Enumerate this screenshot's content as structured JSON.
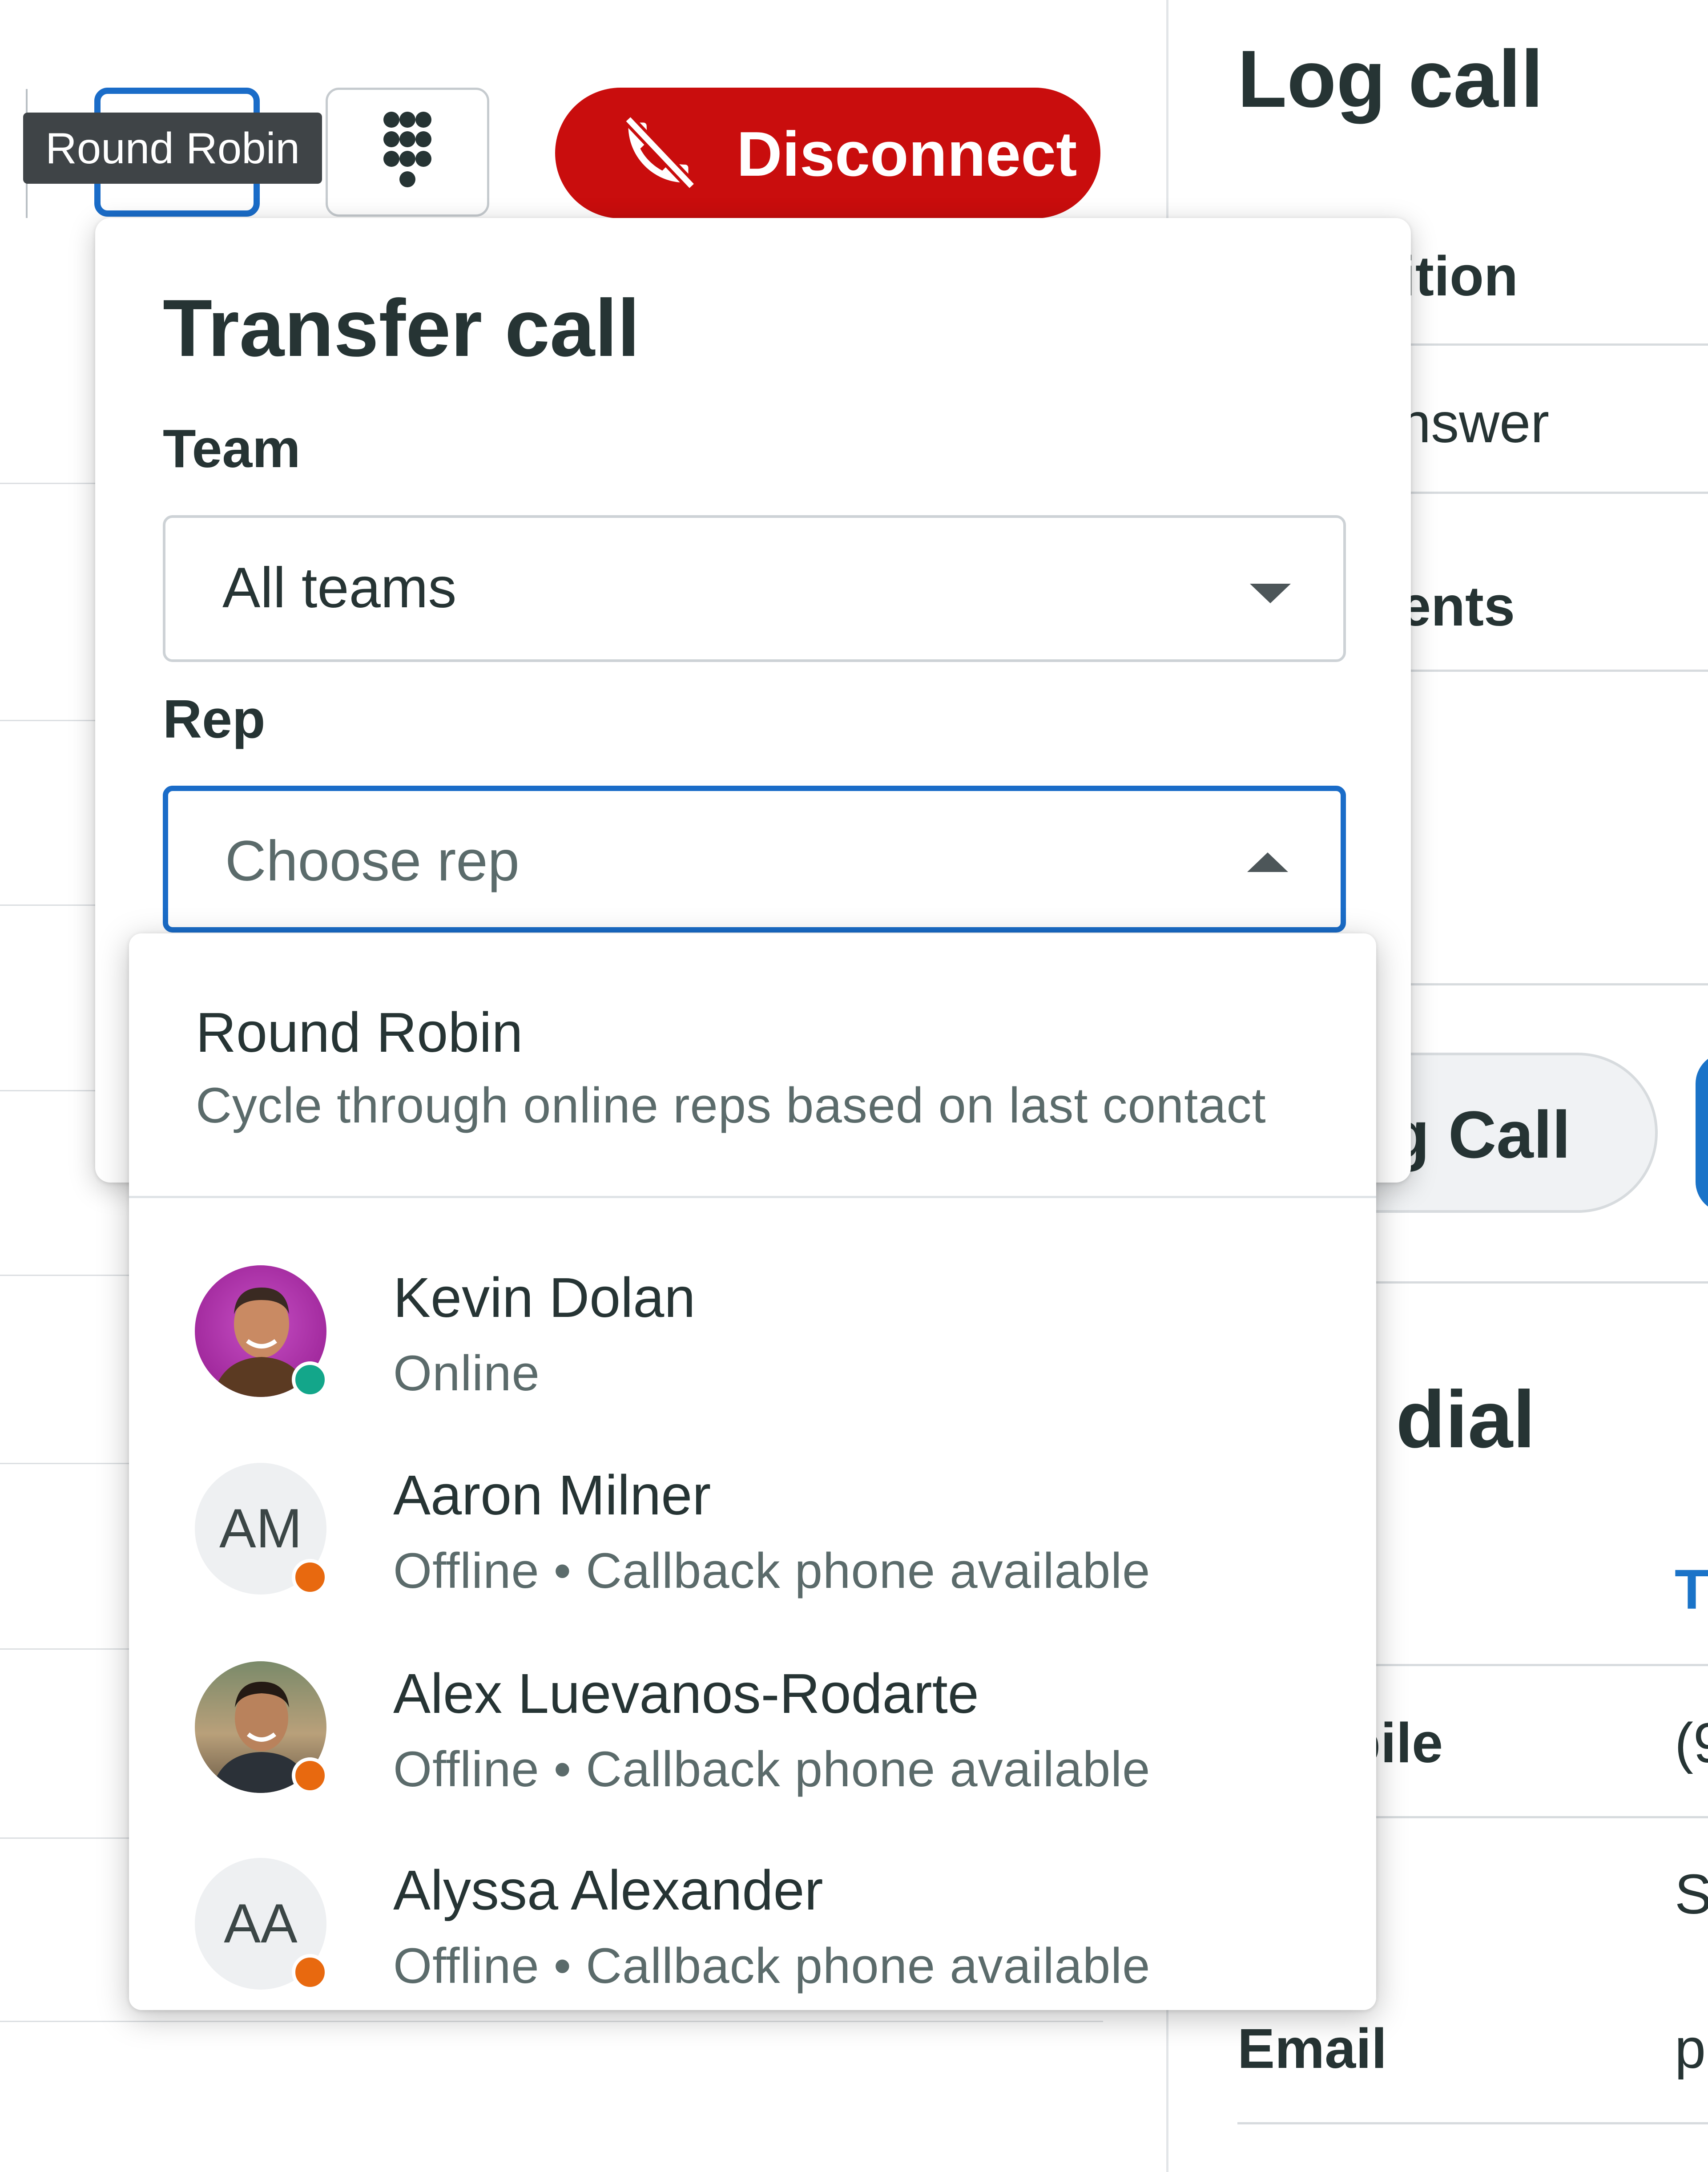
{
  "toolbar": {
    "tooltip": "Round Robin",
    "disconnect_label": "Disconnect"
  },
  "transfer": {
    "title": "Transfer call",
    "team_label": "Team",
    "team_value": "All teams",
    "rep_label": "Rep",
    "rep_placeholder": "Choose rep"
  },
  "dropdown": {
    "round_robin": {
      "title": "Round Robin",
      "description": "Cycle through online reps based on last contact"
    },
    "reps": [
      {
        "name": "Kevin Dolan",
        "status": "Online",
        "initials": "",
        "status_color": "#13a68a"
      },
      {
        "name": "Aaron Milner",
        "status": "Offline • Callback phone available",
        "initials": "AM",
        "status_color": "#e8690f"
      },
      {
        "name": "Alex Luevanos-Rodarte",
        "status": "Offline • Callback phone available",
        "initials": "",
        "status_color": "#e8690f"
      },
      {
        "name": "Alyssa Alexander",
        "status": "Offline • Callback phone available",
        "initials": "AA",
        "status_color": "#e8690f"
      }
    ]
  },
  "log_call": {
    "title": "Log call",
    "disposition_fragment": "ition",
    "answer_fragment": "nswer",
    "comments_fragment": "ents",
    "button_fragment": "g Call",
    "dial_fragment": "t dial",
    "type_fragment": "e",
    "type_value_fragment": "T",
    "mobile_fragment": "bile",
    "mobile_value_fragment": "(9",
    "row3_value_fragment": "S",
    "email_label": "Email",
    "email_value_fragment": "p"
  },
  "colors": {
    "primary": "#1a6cc8",
    "danger": "#c90d0d",
    "online": "#13a68a",
    "offline": "#e8690f",
    "text": "#263434",
    "muted": "#5b6b6b"
  }
}
